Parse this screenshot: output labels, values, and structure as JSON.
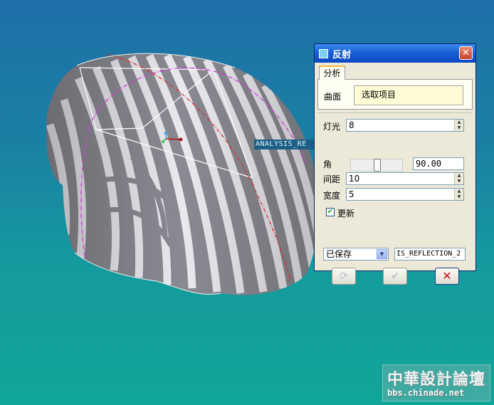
{
  "viewport": {
    "model_label": "ANALYSIS_RE",
    "colors": {
      "background_top": "#1f6fa8",
      "background_bottom": "#11a69a",
      "stripe_light": "#e8e8ec",
      "stripe_dark": "#8a8a92",
      "curve_magenta": "#d23ed6",
      "curve_red": "#e22a2a"
    }
  },
  "dialog": {
    "title": "反射",
    "close_icon": "close-icon",
    "tab": "分析",
    "surface": {
      "label": "曲面",
      "collector_value": "选取项目"
    },
    "light": {
      "label": "灯光",
      "value": "8"
    },
    "angle": {
      "label": "角",
      "value": "90.00",
      "slider_level": 0.5
    },
    "spacing": {
      "label": "间距",
      "value": "10"
    },
    "width": {
      "label": "宽度",
      "value": "5"
    },
    "update": {
      "label": "更新",
      "checked": true
    },
    "saved_select": {
      "value": "已保存"
    },
    "name_field": {
      "value": "IS_REFLECTION_2"
    },
    "buttons": {
      "repeat_icon": "repeat-icon",
      "ok_icon": "checkmark-icon",
      "cancel_icon": "cancel-x-icon"
    }
  },
  "watermark": {
    "title": "中華設計論壇",
    "url": "bbs.chinade.net"
  }
}
